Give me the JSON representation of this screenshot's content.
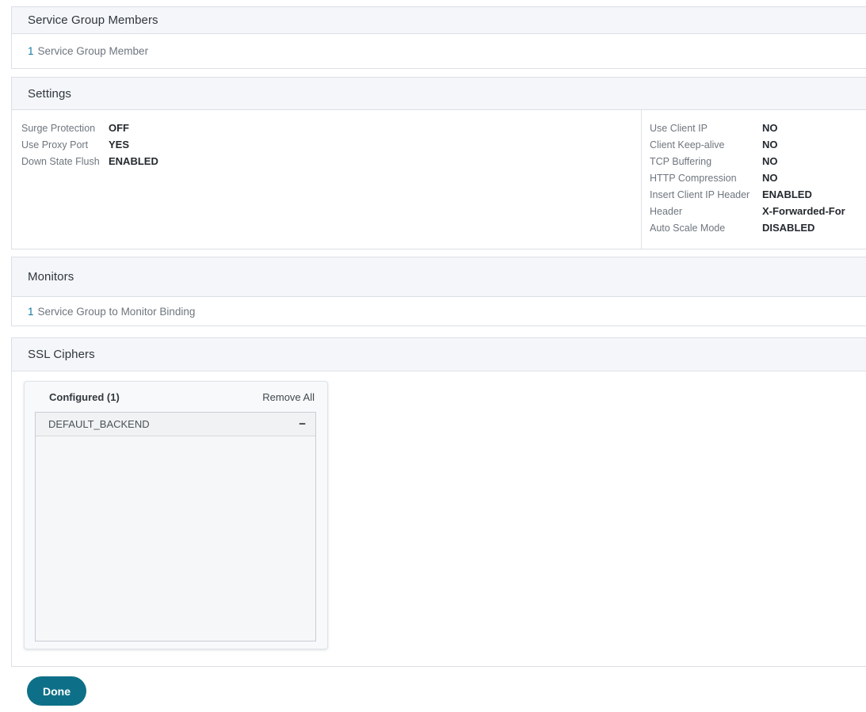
{
  "colors": {
    "accent_teal": "#0e7088",
    "link_blue": "#0e7ba3",
    "band_bg": "#f4f6f9"
  },
  "sections": {
    "service_group_members": {
      "title": "Service Group Members",
      "count": "1",
      "link_text": "Service Group Member"
    },
    "settings": {
      "title": "Settings",
      "left": [
        {
          "label": "Surge Protection",
          "value": "OFF"
        },
        {
          "label": "Use Proxy Port",
          "value": "YES"
        },
        {
          "label": "Down State Flush",
          "value": "ENABLED"
        }
      ],
      "right": [
        {
          "label": "Use Client IP",
          "value": "NO"
        },
        {
          "label": "Client Keep-alive",
          "value": "NO"
        },
        {
          "label": "TCP Buffering",
          "value": "NO"
        },
        {
          "label": "HTTP Compression",
          "value": "NO"
        },
        {
          "label": "Insert Client IP Header",
          "value": "ENABLED"
        },
        {
          "label": "Header",
          "value": "X-Forwarded-For"
        },
        {
          "label": "Auto Scale Mode",
          "value": "DISABLED"
        }
      ]
    },
    "monitors": {
      "title": "Monitors",
      "count": "1",
      "link_text": "Service Group to Monitor Binding"
    },
    "ssl_ciphers": {
      "title": "SSL Ciphers",
      "configured_label": "Configured (1)",
      "remove_all_label": "Remove All",
      "items": [
        {
          "name": "DEFAULT_BACKEND",
          "remove_glyph": "−"
        }
      ]
    }
  },
  "footer": {
    "done_label": "Done"
  }
}
